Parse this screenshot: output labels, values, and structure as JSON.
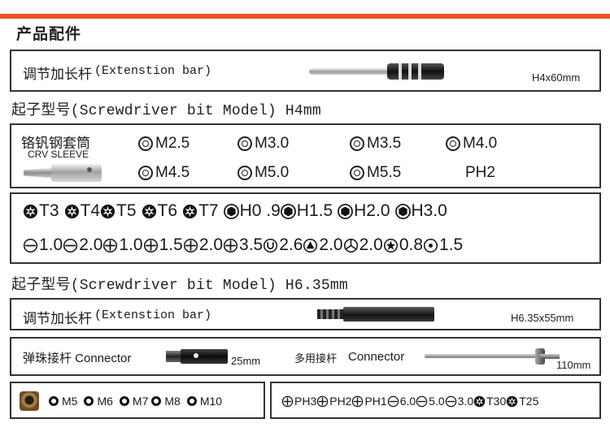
{
  "page": {
    "title": "产品配件"
  },
  "bar_h4": {
    "label": "调节加长杆",
    "label_en": "(Extenstion bar)",
    "dimension": "H4x60mm"
  },
  "heading_h4": {
    "text": "起子型号(Screwdriver bit Model) H4mm"
  },
  "crv_sleeve": {
    "label": "铬钒钢套筒",
    "label_en": "CRV SLEEVE",
    "sizes": [
      "M2.5",
      "M3.0",
      "M3.5",
      "M4.0",
      "M4.5",
      "M5.0",
      "M5.5",
      "PH2"
    ]
  },
  "bits_h4": {
    "row1": [
      {
        "icon": "torx-icon",
        "text": "T3"
      },
      {
        "icon": "torx-icon",
        "text": " T4"
      },
      {
        "icon": "torx-icon",
        "text": "T5"
      },
      {
        "icon": "torx-icon",
        "text": "T6"
      },
      {
        "icon": "torx-icon",
        "text": "T7"
      },
      {
        "icon": "hex-icon",
        "text": " H0 .9"
      },
      {
        "icon": "hex-icon",
        "text": "H1.5"
      },
      {
        "icon": "hex-icon",
        "text": " H2.0"
      },
      {
        "icon": "hex-icon",
        "text": " H3.0"
      }
    ],
    "row2": [
      {
        "icon": "slotted-icon",
        "text": "1.0"
      },
      {
        "icon": "slotted-icon",
        "text": "2.0"
      },
      {
        "icon": "phillips-icon",
        "text": "1.0"
      },
      {
        "icon": "phillips-icon",
        "text": " 1.5"
      },
      {
        "icon": "phillips-icon",
        "text": " 2.0"
      },
      {
        "icon": "phillips-icon",
        "text": " 3.5"
      },
      {
        "icon": "u-type-icon",
        "text": "2.6"
      },
      {
        "icon": "triangle-icon",
        "text": "2.0"
      },
      {
        "icon": "y-type-icon",
        "text": "2.0"
      },
      {
        "icon": "pentalobe-icon",
        "text": "0.8"
      },
      {
        "icon": "pin-icon",
        "text": "1.5"
      }
    ]
  },
  "heading_h635": {
    "text": "起子型号(Screwdriver bit Model) H6.35mm"
  },
  "bar_h635": {
    "label": "调节加长杆",
    "label_en": "(Extenstion bar)",
    "dimension": "H6.35x55mm"
  },
  "connectors": {
    "spring": {
      "label": "弹珠接杆 Connector",
      "dimension": "25mm"
    },
    "multi": {
      "label": "多用接杆",
      "label_en": "Connector",
      "dimension": "110mm"
    }
  },
  "socket_sizes": [
    "M5",
    "M6",
    "M7",
    "M8",
    "M10"
  ],
  "bits_h635": [
    {
      "icon": "phillips-icon",
      "text": "PH3"
    },
    {
      "icon": "phillips-icon",
      "text": "PH2"
    },
    {
      "icon": "phillips-icon",
      "text": "PH1"
    },
    {
      "icon": "slotted-icon",
      "text": "6.0"
    },
    {
      "icon": "slotted-icon",
      "text": "5.0"
    },
    {
      "icon": "slotted-icon",
      "text": "3.0"
    },
    {
      "icon": "torx-icon",
      "text": "T30"
    },
    {
      "icon": "torx-icon",
      "text": "T25"
    }
  ],
  "colors": {
    "accent": "#e4571c",
    "border": "#333333"
  }
}
